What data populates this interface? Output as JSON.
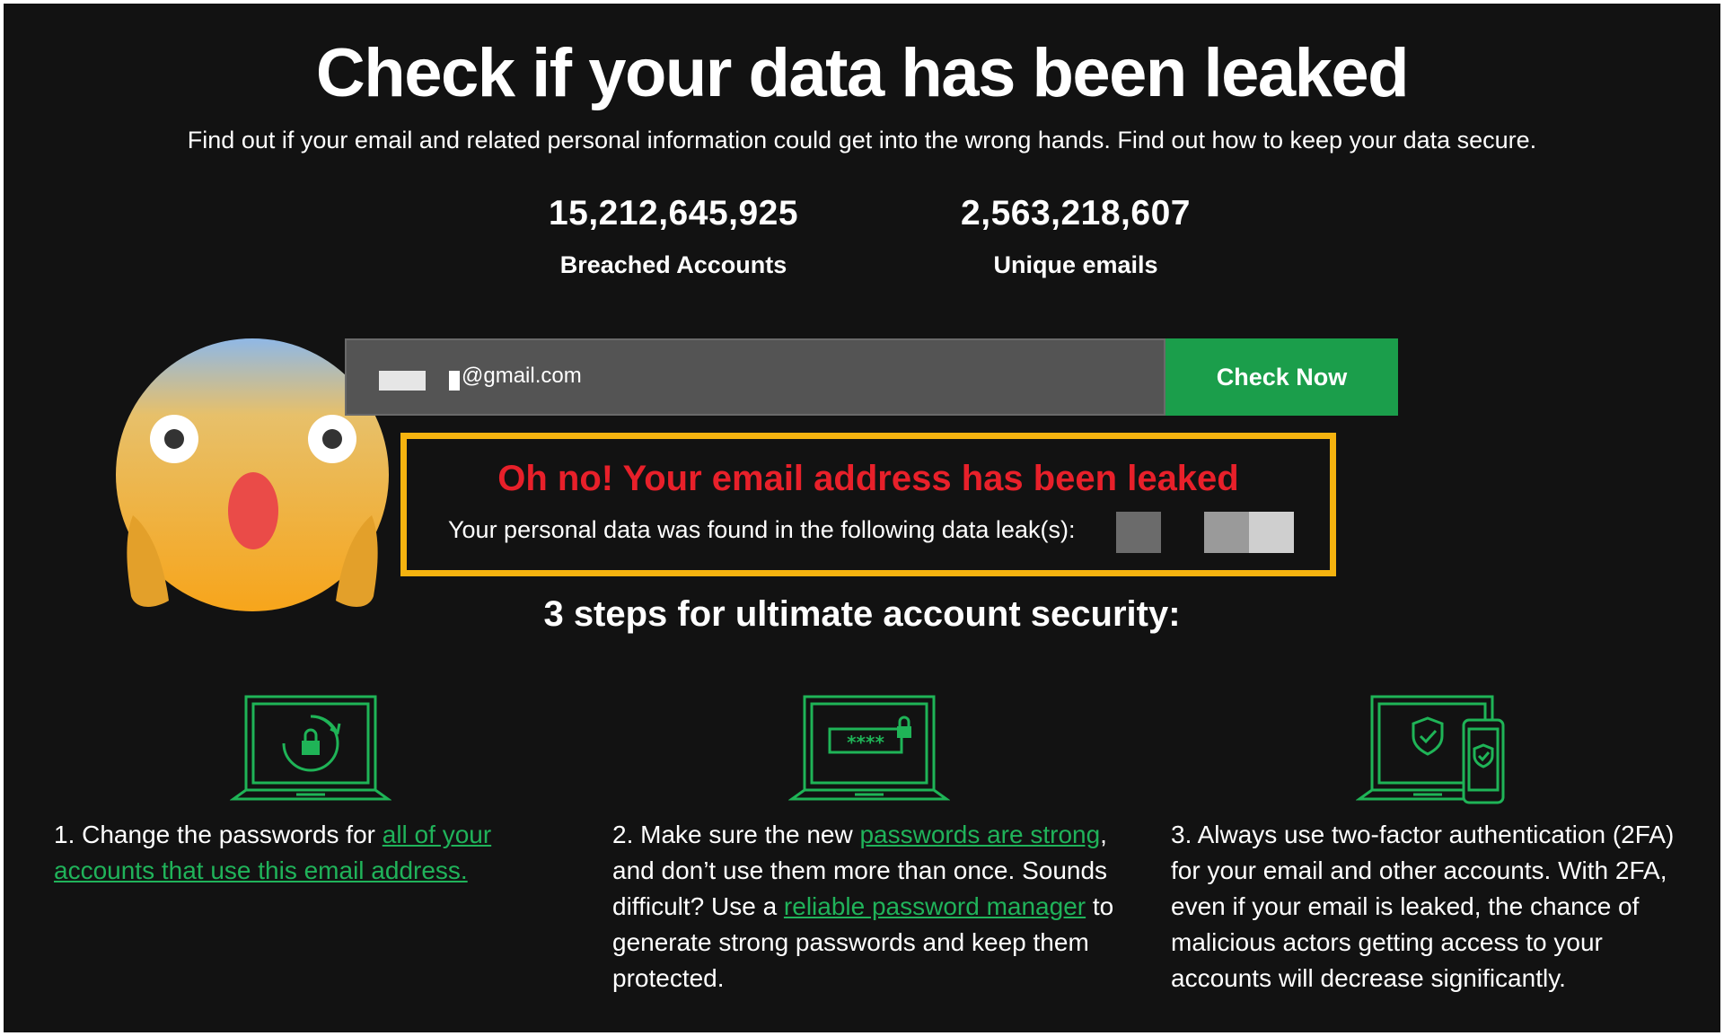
{
  "header": {
    "title": "Check if your data has been leaked",
    "subtitle": "Find out if your email and related personal information could get into the wrong hands. Find out how to keep your data secure."
  },
  "stats": [
    {
      "value": "15,212,645,925",
      "label": "Breached Accounts"
    },
    {
      "value": "2,563,218,607",
      "label": "Unique emails"
    }
  ],
  "search": {
    "email_value": "@gmail.com",
    "button_label": "Check Now"
  },
  "alert": {
    "title": "Oh no! Your email address has been leaked",
    "body": "Your personal data was found in the following data leak(s):"
  },
  "steps_heading": "3 steps for ultimate account security:",
  "steps": [
    {
      "icon": "laptop-lock-refresh-icon",
      "prefix": "1. Change the passwords for ",
      "link": "all of your accounts that use this email address."
    },
    {
      "icon": "laptop-password-icon",
      "prefix": "2. Make sure the new ",
      "link1": "passwords are strong",
      "middle": ", and don’t use them more than once. Sounds difficult? Use a ",
      "link2": "reliable password manager",
      "suffix": " to generate strong passwords and keep them protected."
    },
    {
      "icon": "laptop-phone-shield-icon",
      "text": "3. Always use two-factor authentication (2FA) for your email and other accounts. With 2FA, even if your email is leaked, the chance of malicious actors getting access to your accounts will decrease significantly."
    }
  ],
  "colors": {
    "background": "#121212",
    "accent_green": "#1b9e4b",
    "link_green": "#20b35a",
    "alert_red": "#e8202a",
    "alert_border": "#f5b30f"
  }
}
